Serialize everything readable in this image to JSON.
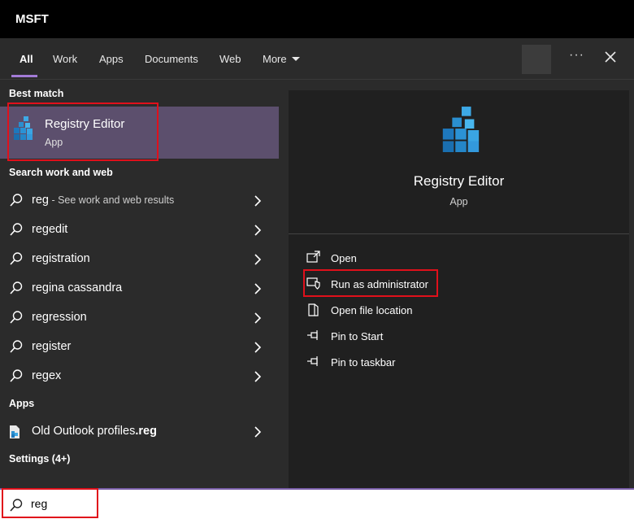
{
  "window": {
    "title": "MSFT"
  },
  "tabs": [
    {
      "label": "All",
      "active": true
    },
    {
      "label": "Work"
    },
    {
      "label": "Apps"
    },
    {
      "label": "Documents"
    },
    {
      "label": "Web"
    },
    {
      "label": "More"
    }
  ],
  "toolbar": {
    "more_options": "···"
  },
  "left": {
    "best_match_header": "Best match",
    "best_match": {
      "title": "Registry Editor",
      "subtitle": "App",
      "icon": "registry-editor-icon"
    },
    "search_header": "Search work and web",
    "suggestions": [
      {
        "text": "reg",
        "sub": " - See work and web results"
      },
      {
        "text": "regedit"
      },
      {
        "text": "registration"
      },
      {
        "text": "regina cassandra"
      },
      {
        "text": "regression"
      },
      {
        "text": "register"
      },
      {
        "text": "regex"
      }
    ],
    "apps_header": "Apps",
    "apps": [
      {
        "name": "Old Outlook profiles",
        "ext": ".reg"
      }
    ],
    "settings_header": "Settings (4+)"
  },
  "right": {
    "app_title": "Registry Editor",
    "app_subtitle": "App",
    "actions": [
      {
        "label": "Open",
        "icon": "open-icon"
      },
      {
        "label": "Run as administrator",
        "icon": "shield-icon"
      },
      {
        "label": "Open file location",
        "icon": "folder-icon"
      },
      {
        "label": "Pin to Start",
        "icon": "pin-icon"
      },
      {
        "label": "Pin to taskbar",
        "icon": "pin-icon"
      }
    ]
  },
  "search": {
    "value": "reg"
  },
  "colors": {
    "accent": "#a37bd6",
    "highlight": "#5c4f6d",
    "annotation": "#e0101b"
  }
}
